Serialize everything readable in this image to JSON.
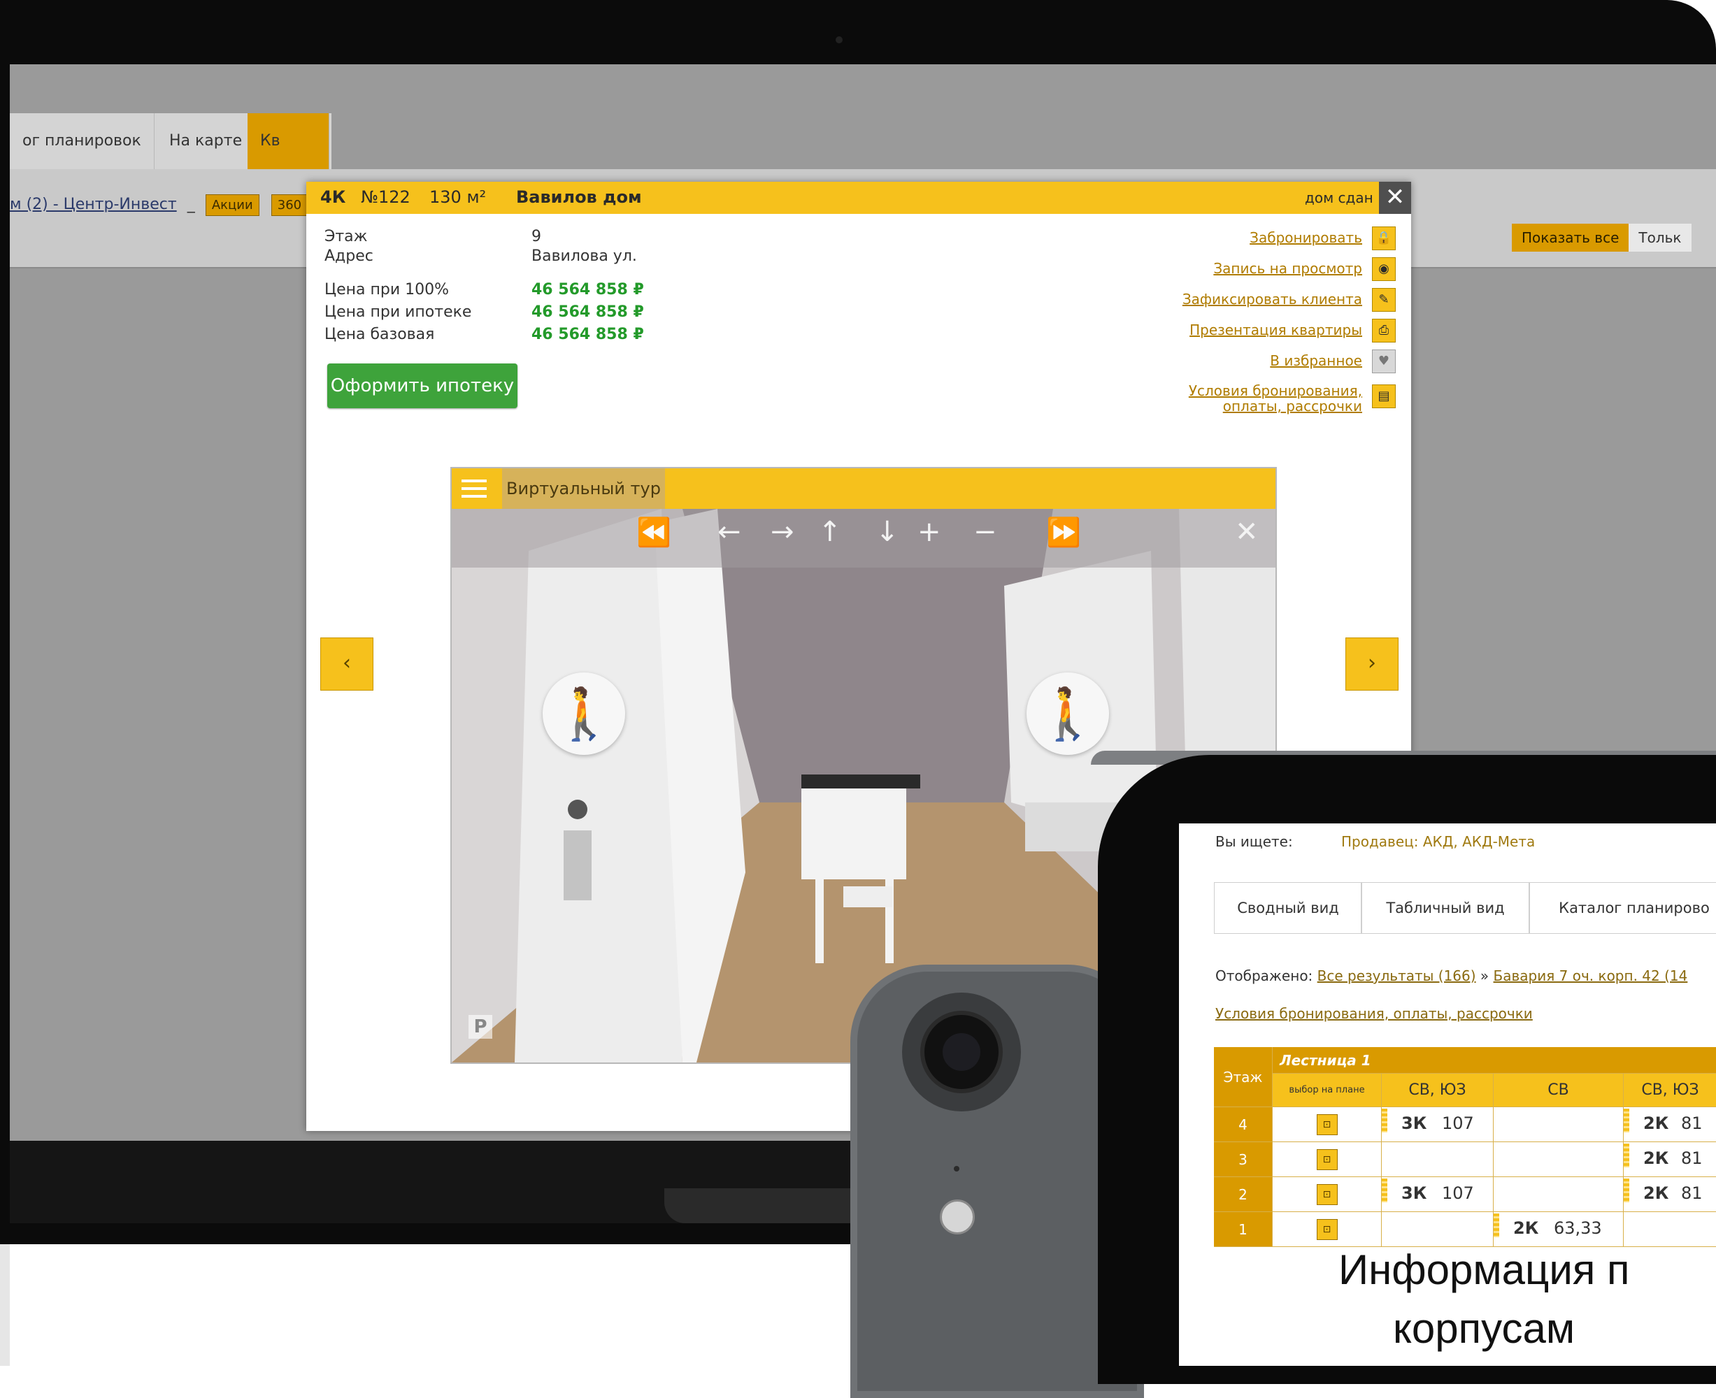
{
  "background_app": {
    "tabs": [
      "ог планировок",
      "На карте",
      "Кв"
    ],
    "breadcrumb_link": "м (2) - Центр-Инвест",
    "breadcrumb_sep": "_",
    "chip_promo": "Акции",
    "chip_360": "360",
    "show_all": "Показать все",
    "only": "Тольк"
  },
  "modal": {
    "rooms": "4К",
    "number": "№122",
    "area": "130 м²",
    "project": "Вавилов дом",
    "status": "дом сдан",
    "close": "✕",
    "floor_label": "Этаж",
    "floor_value": "9",
    "address_label": "Адрес",
    "address_value": "Вавилова ул.",
    "price_full_label": "Цена при 100%",
    "price_full_value": "46 564 858 ₽",
    "price_mortgage_label": "Цена при ипотеке",
    "price_mortgage_value": "46 564 858 ₽",
    "price_base_label": "Цена базовая",
    "price_base_value": "46 564 858 ₽",
    "mortgage_button": "Оформить ипотеку",
    "actions": [
      {
        "label": "Забронировать",
        "icon": "lock-icon",
        "glyph": "🔒"
      },
      {
        "label": "Запись на просмотр",
        "icon": "eye-icon",
        "glyph": "◉"
      },
      {
        "label": "Зафиксировать клиента",
        "icon": "pin-icon",
        "glyph": "✎"
      },
      {
        "label": "Презентация квартиры",
        "icon": "print-icon",
        "glyph": "⎙"
      },
      {
        "label": "В избранное",
        "icon": "heart-icon",
        "glyph": "♥"
      },
      {
        "label_line1": "Условия бронирования,",
        "label_line2": "оплаты, рассрочки",
        "icon": "document-icon",
        "glyph": "▤"
      }
    ]
  },
  "tour": {
    "title": "Виртуальный тур",
    "controls": [
      "⏪",
      "←",
      "→",
      "↑",
      "↓",
      "+",
      "−",
      "⏩",
      "✕"
    ],
    "walk_glyph": "🚶",
    "prev": "‹",
    "next": "›",
    "watermark": "P"
  },
  "tablet": {
    "search_label": "Вы ищете:",
    "seller_text": "Продавец: АКД, АКД-Мета",
    "tabs": [
      "Сводный вид",
      "Табличный вид",
      "Каталог планирово"
    ],
    "shown_label": "Отображено:",
    "shown_all": "Все результаты (166)",
    "shown_sep": "»",
    "shown_building": "Бавария 7 оч. корп. 42 (14",
    "conditions_link": "Условия бронирования, оплаты, рассрочки",
    "grid": {
      "floor_header": "Этаж",
      "stair_header": "Лестница 1",
      "plan_header": "выбор на плане",
      "col_headers": [
        "СВ, ЮЗ",
        "СВ",
        "СВ, ЮЗ"
      ],
      "rows": [
        {
          "floor": "4",
          "c1_type": "3К",
          "c1_area": "107",
          "c2_type": "",
          "c2_area": "",
          "c3_type": "2К",
          "c3_area": "81"
        },
        {
          "floor": "3",
          "c1_type": "",
          "c1_area": "",
          "c2_type": "",
          "c2_area": "",
          "c3_type": "2К",
          "c3_area": "81"
        },
        {
          "floor": "2",
          "c1_type": "3К",
          "c1_area": "107",
          "c2_type": "",
          "c2_area": "",
          "c3_type": "2К",
          "c3_area": "81"
        },
        {
          "floor": "1",
          "c1_type": "",
          "c1_area": "",
          "c2_type": "2К",
          "c2_area": "63,33",
          "c3_type": "",
          "c3_area": ""
        }
      ]
    }
  },
  "caption": {
    "line1": "Информация п",
    "line2": "корпусам"
  },
  "colors": {
    "accent": "#f6c11c",
    "green": "#3ea33b",
    "price_green": "#239a2a"
  }
}
